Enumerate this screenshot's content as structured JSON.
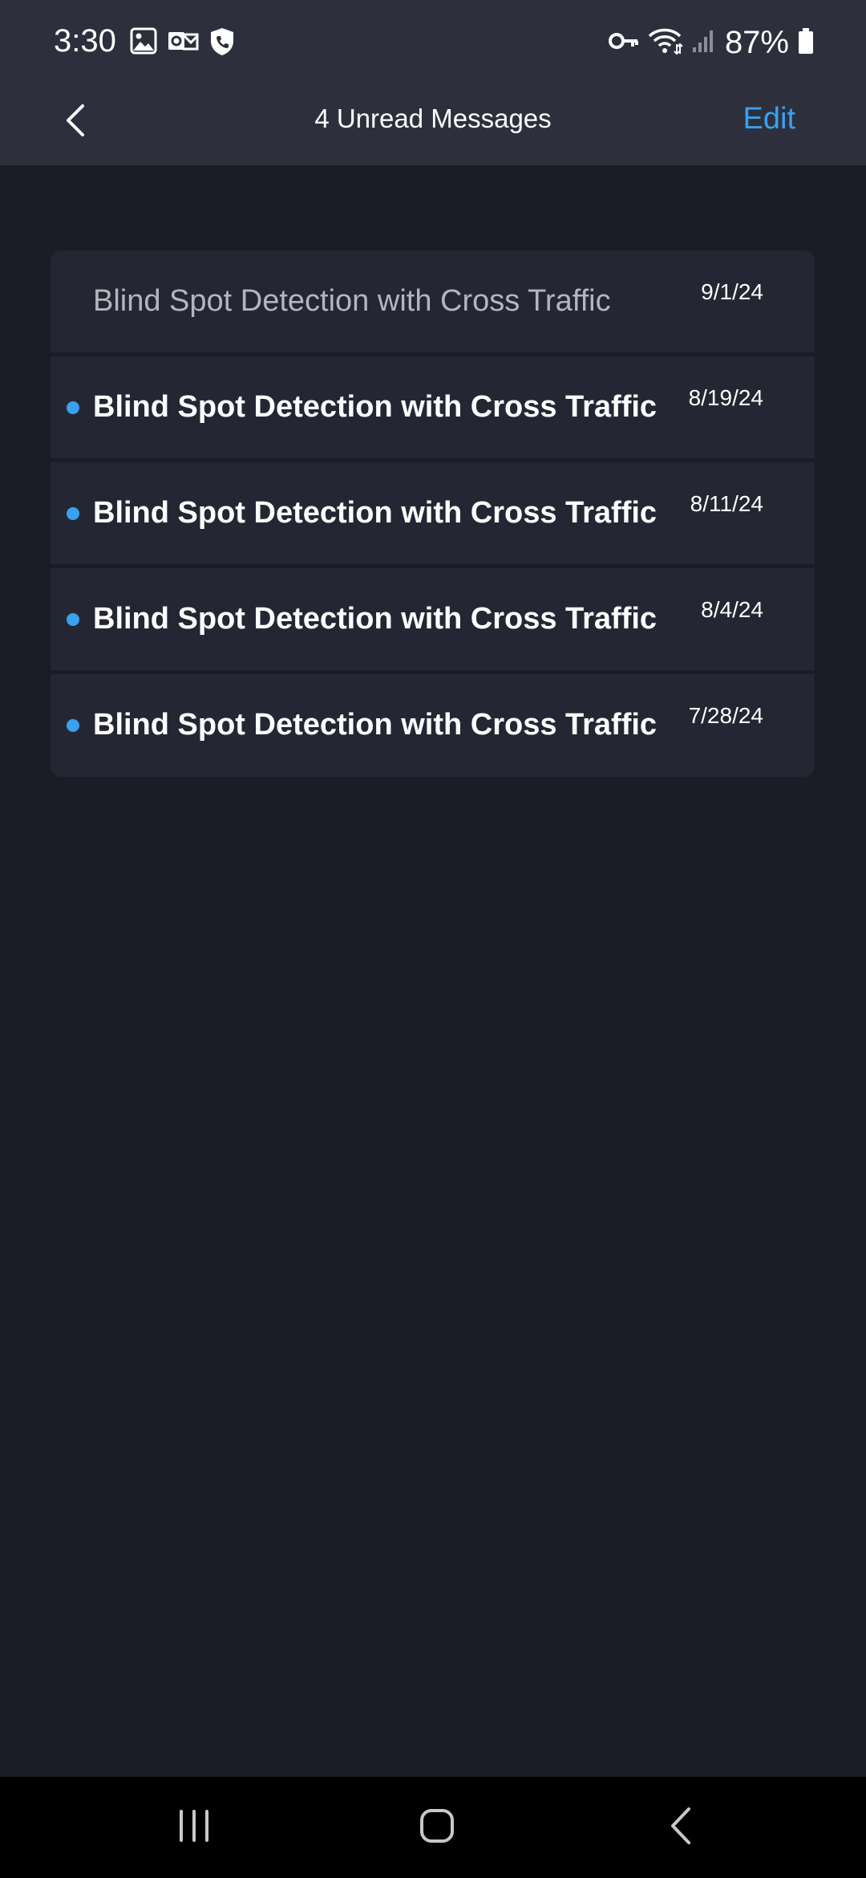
{
  "status_bar": {
    "time": "3:30",
    "battery": "87%",
    "left_icons": [
      "image-icon",
      "outlook-icon",
      "shield-phone-icon"
    ],
    "right_icons": [
      "vpn-key-icon",
      "wifi-icon",
      "signal-icon",
      "battery-icon"
    ]
  },
  "header": {
    "title": "4 Unread Messages",
    "edit_label": "Edit",
    "back_icon": "chevron-left-icon"
  },
  "messages": [
    {
      "title": "Blind Spot Detection with Cross Traffic",
      "date": "9/1/24",
      "unread": false
    },
    {
      "title": "Blind Spot Detection with Cross Traffic",
      "date": "8/19/24",
      "unread": true
    },
    {
      "title": "Blind Spot Detection with Cross Traffic",
      "date": "8/11/24",
      "unread": true
    },
    {
      "title": "Blind Spot Detection with Cross Traffic",
      "date": "8/4/24",
      "unread": true
    },
    {
      "title": "Blind Spot Detection with Cross Traffic",
      "date": "7/28/24",
      "unread": true
    }
  ],
  "nav_bar": {
    "icons": [
      "recents-icon",
      "home-icon",
      "back-icon"
    ]
  },
  "colors": {
    "accent": "#3aa0f0",
    "background": "#1a1c26",
    "header": "#2d303c",
    "row": "#242733"
  }
}
